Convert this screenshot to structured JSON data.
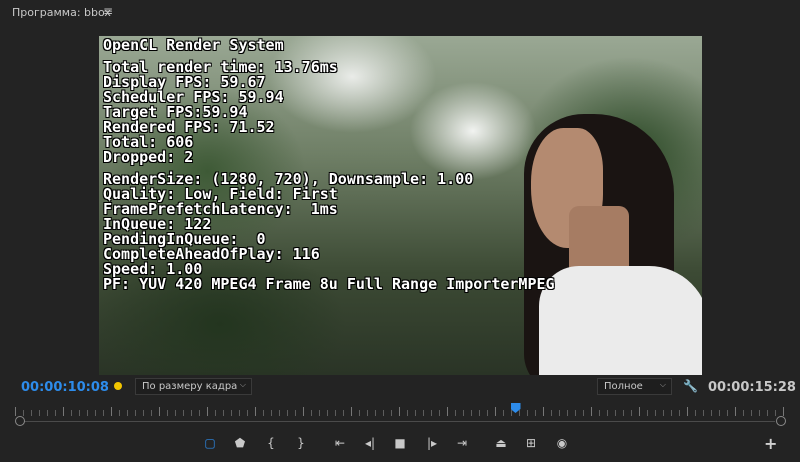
{
  "panel": {
    "title": "Программа: bbox",
    "menu_icon": "≡"
  },
  "overlay": {
    "group1": [
      "OpenCL Render System"
    ],
    "group2": [
      "Total render time: 13.76ms",
      "Display FPS: 59.67",
      "Scheduler FPS: 59.94",
      "Target FPS:59.94",
      "Rendered FPS: 71.52",
      "Total: 606",
      "Dropped: 2"
    ],
    "group3": [
      "RenderSize: (1280, 720), Downsample: 1.00",
      "Quality: Low, Field: First",
      "FramePrefetchLatency:  1ms",
      "InQueue: 122",
      "PendingInQueue:  0",
      "CompleteAheadOfPlay: 116",
      "Speed: 1.00",
      "PF: YUV 420 MPEG4 Frame 8u Full Range ImporterMPEG"
    ]
  },
  "controls": {
    "current_timecode": "00:00:10:08",
    "zoom_select": "По размеру кадра",
    "quality_select": "Полное",
    "duration_timecode": "00:00:15:28",
    "playhead_fraction": 0.65
  },
  "transport": {
    "buttons": [
      {
        "name": "marker-comment-icon",
        "glyph": "▢"
      },
      {
        "name": "add-marker-icon",
        "glyph": "⬟"
      },
      {
        "name": "mark-in-icon",
        "glyph": "{"
      },
      {
        "name": "mark-out-icon",
        "glyph": "}"
      },
      {
        "name": "go-to-in-icon",
        "glyph": "⇤"
      },
      {
        "name": "step-back-icon",
        "glyph": "◂|"
      },
      {
        "name": "stop-icon",
        "glyph": "■"
      },
      {
        "name": "step-forward-icon",
        "glyph": "|▸"
      },
      {
        "name": "go-to-out-icon",
        "glyph": "⇥"
      },
      {
        "name": "lift-icon",
        "glyph": "⏏"
      },
      {
        "name": "extract-icon",
        "glyph": "⊞"
      },
      {
        "name": "export-frame-icon",
        "glyph": "◉"
      }
    ],
    "add_button": "+"
  },
  "colors": {
    "accent": "#2d8ceb",
    "marker": "#f2c500",
    "background": "#232323"
  }
}
